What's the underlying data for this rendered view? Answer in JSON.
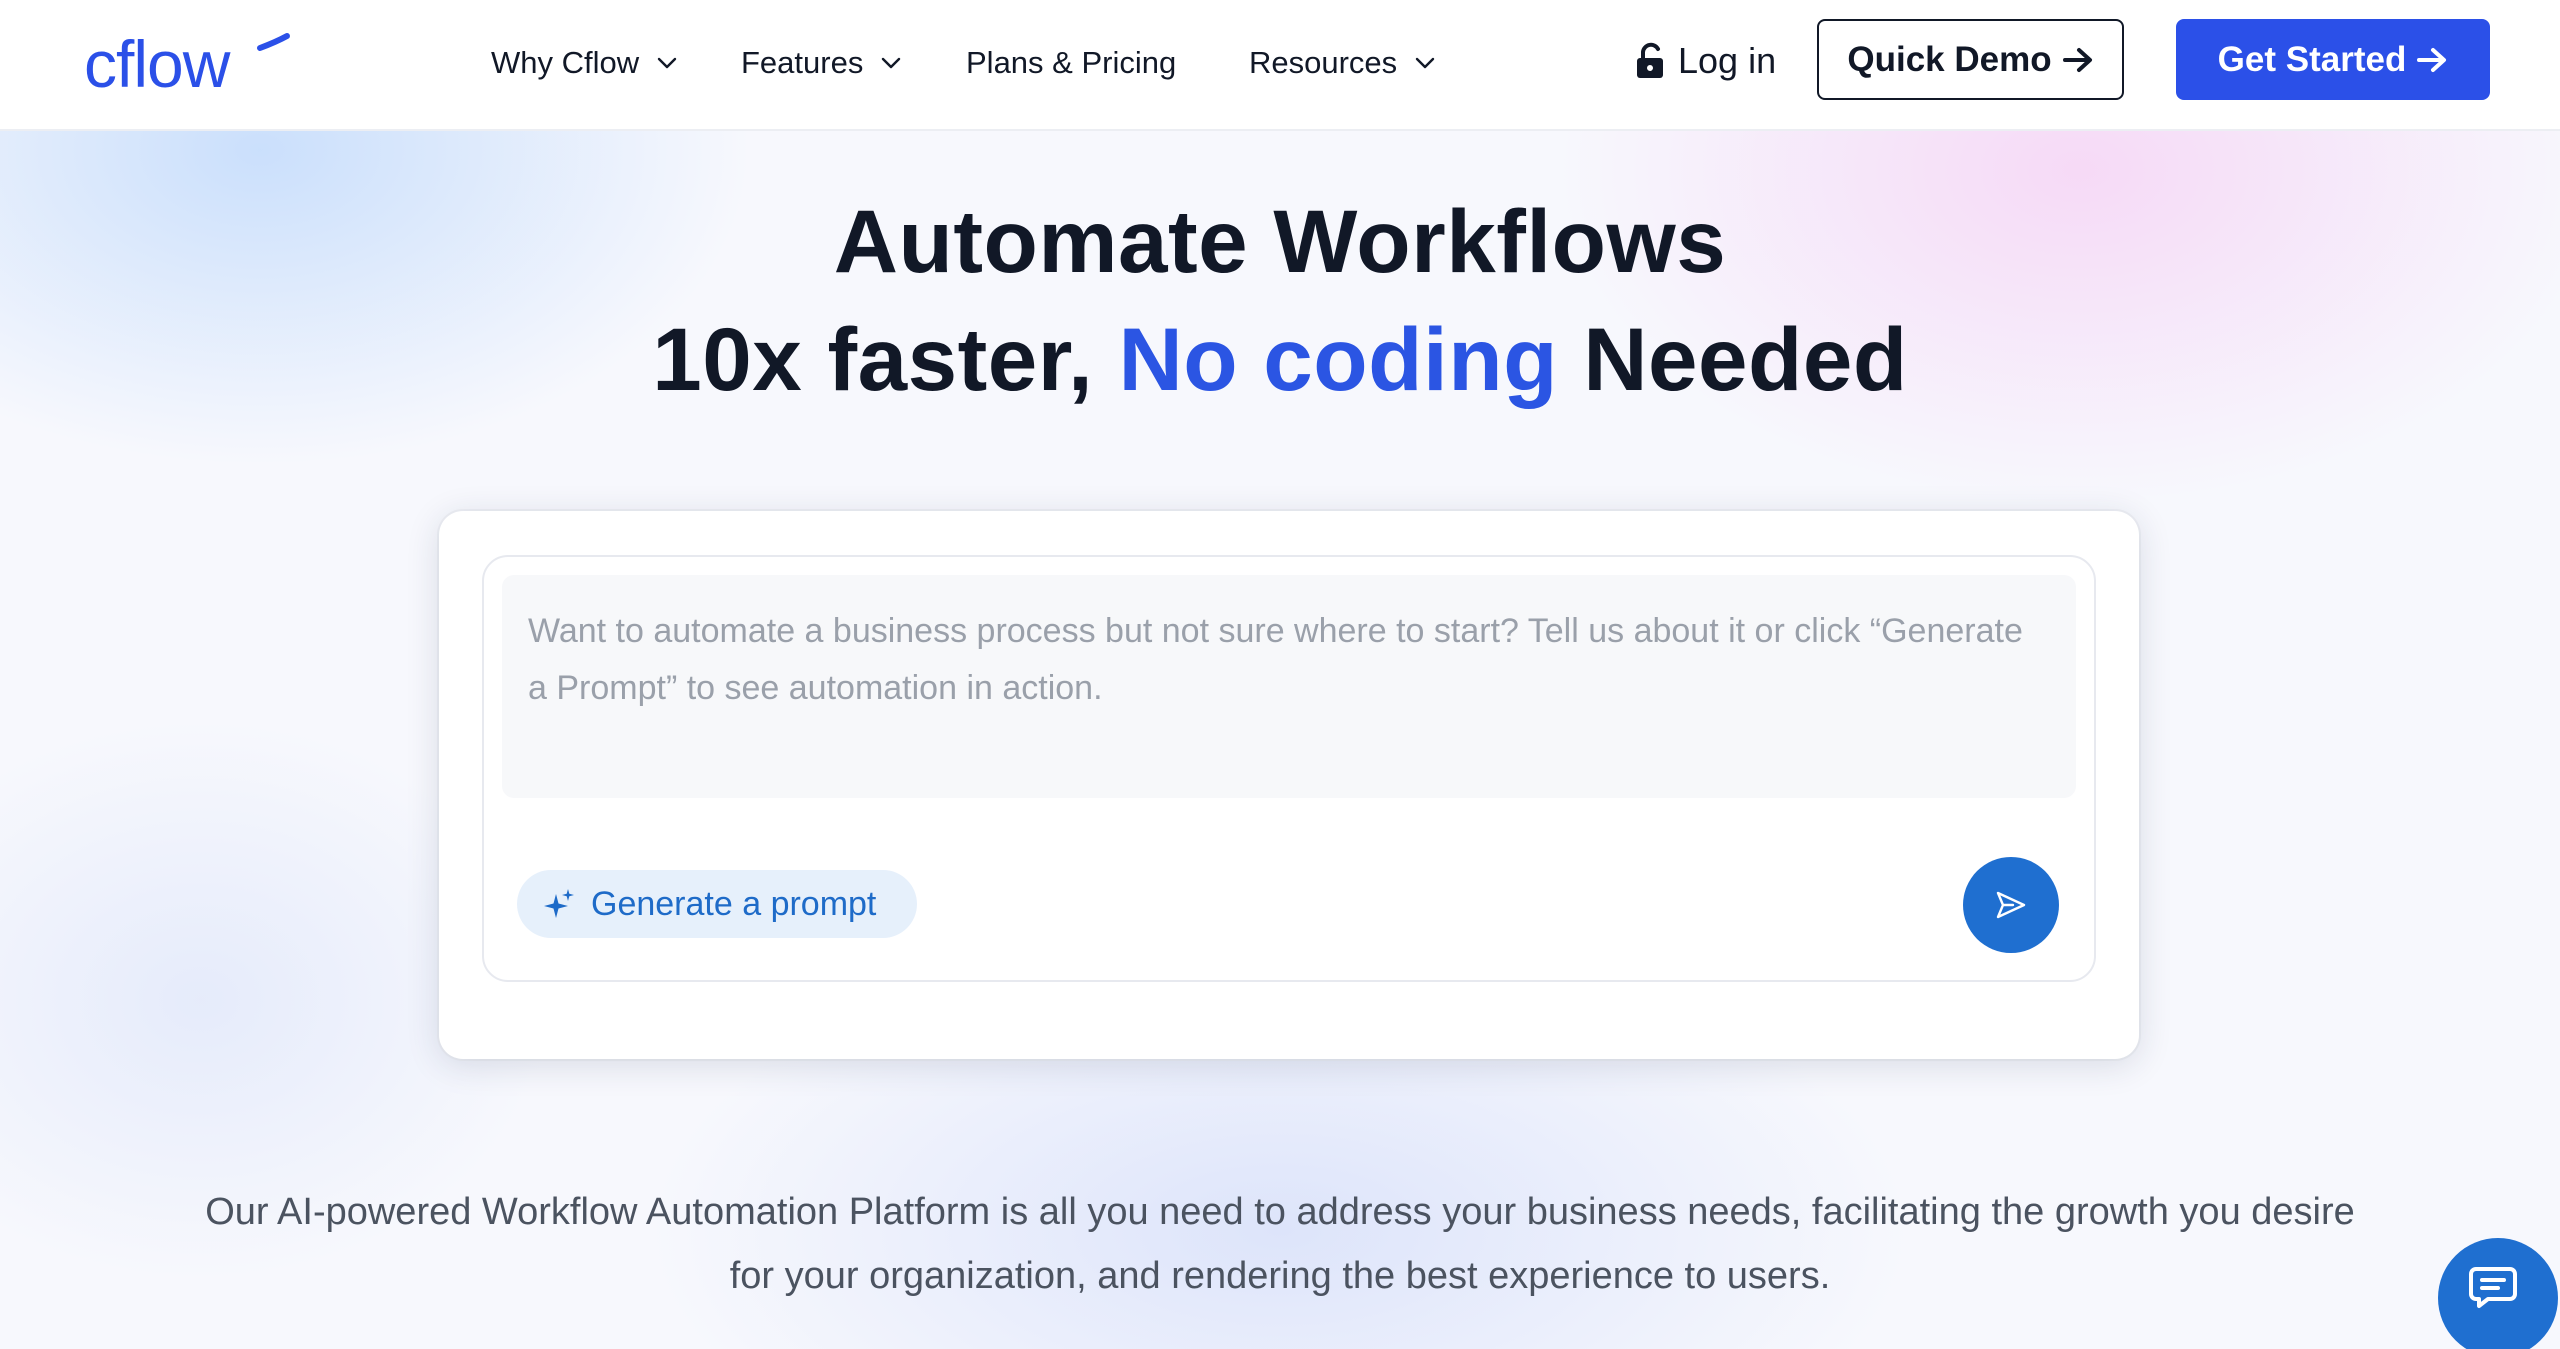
{
  "header": {
    "logo_text": "cflow",
    "nav": [
      {
        "label": "Why Cflow",
        "has_dropdown": true
      },
      {
        "label": "Features",
        "has_dropdown": true
      },
      {
        "label": "Plans & Pricing",
        "has_dropdown": false
      },
      {
        "label": "Resources",
        "has_dropdown": true
      }
    ],
    "login_label": "Log in",
    "quick_demo_label": "Quick Demo",
    "get_started_label": "Get Started"
  },
  "hero": {
    "title_line1": "Automate Workflows",
    "title_line2_before": "10x faster, ",
    "title_line2_highlight": "No coding",
    "title_line2_after": " Needed",
    "prompt_placeholder": "Want to automate a business process but not sure where to start? Tell us about it or click “Generate a Prompt” to see automation in action.",
    "generate_label": "Generate a prompt",
    "description": "Our AI-powered Workflow Automation Platform is all you need to address your business needs, facilitating the growth you desire for your organization, and rendering the best experience to users."
  },
  "colors": {
    "brand_blue": "#2b50e8",
    "accent_blue": "#1f6fd0",
    "highlight_blue": "#2b55e3",
    "text_dark": "#111827"
  },
  "icons": {
    "lock": "unlock-icon",
    "arrow": "arrow-right-icon",
    "chevron": "chevron-down-icon",
    "sparkle": "sparkle-icon",
    "send": "send-icon",
    "chat": "chat-icon"
  }
}
